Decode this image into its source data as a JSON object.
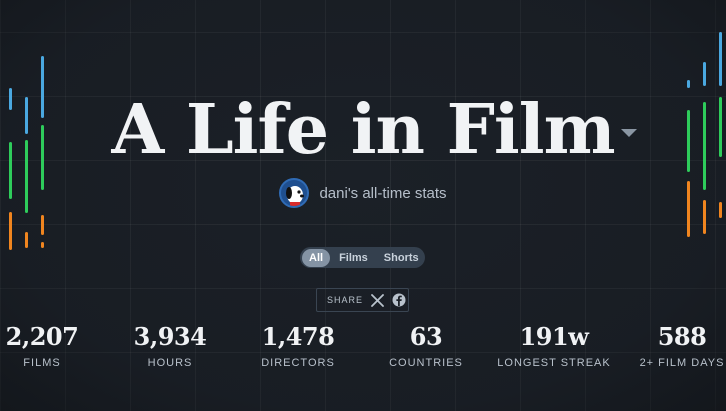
{
  "header": {
    "title": "A Life in Film"
  },
  "user": {
    "subtitle": "dani's all-time stats"
  },
  "filters": {
    "options": [
      "All",
      "Films",
      "Shorts"
    ],
    "selected": "All"
  },
  "share": {
    "label": "SHARE",
    "x_icon": "x-logo-icon",
    "facebook_icon": "facebook-icon"
  },
  "stats": [
    {
      "value": "2,207",
      "label": "FILMS"
    },
    {
      "value": "3,934",
      "label": "HOURS"
    },
    {
      "value": "1,478",
      "label": "DIRECTORS"
    },
    {
      "value": "63",
      "label": "COUNTRIES"
    },
    {
      "value": "191w",
      "label": "LONGEST STREAK"
    },
    {
      "value": "588",
      "label": "2+ FILM DAYS"
    }
  ],
  "colors": {
    "background": "#1b2027",
    "blue": "#4aa8e0",
    "green": "#2ecc5b",
    "orange": "#f0851f",
    "filter_active": "#8493a4"
  }
}
